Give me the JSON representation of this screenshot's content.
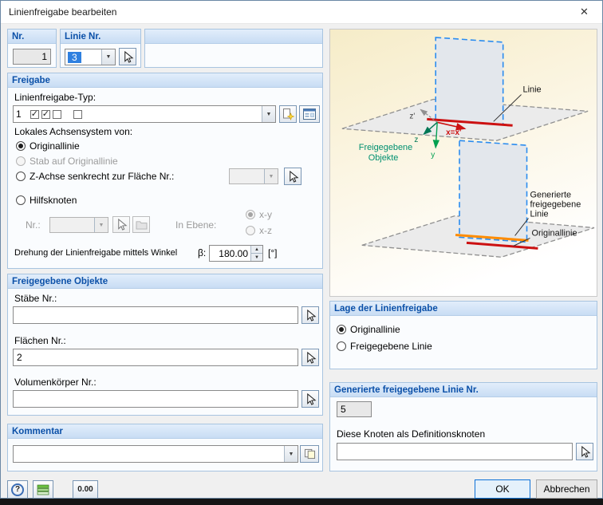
{
  "window": {
    "title": "Linienfreigabe bearbeiten",
    "close_icon": "✕"
  },
  "header_groups": {
    "nr": {
      "title": "Nr.",
      "value": "1"
    },
    "linie": {
      "title": "Linie Nr.",
      "value": "3"
    }
  },
  "freigabe": {
    "title": "Freigabe",
    "typ_label": "Linienfreigabe-Typ:",
    "typ_value": "1",
    "achsen_label": "Lokales Achsensystem von:",
    "radio_originallinie": "Originallinie",
    "radio_stab": "Stab auf Originallinie",
    "radio_zachse": "Z-Achse senkrecht zur Fläche Nr.:",
    "radio_hilfsknoten": "Hilfsknoten",
    "nr_label": "Nr.:",
    "in_ebene_label": "In Ebene:",
    "radio_xy": "x-y",
    "radio_xz": "x-z",
    "drehung_label": "Drehung der Linienfreigabe mittels Winkel",
    "beta_label": "β:",
    "beta_value": "180.00",
    "unit_label": "[°]"
  },
  "objekte": {
    "title": "Freigegebene Objekte",
    "staebe_label": "Stäbe Nr.:",
    "staebe_value": "",
    "flaechen_label": "Flächen Nr.:",
    "flaechen_value": "2",
    "volumen_label": "Volumenkörper Nr.:",
    "volumen_value": ""
  },
  "kommentar": {
    "title": "Kommentar",
    "value": ""
  },
  "diagram": {
    "label_linie": "Linie",
    "label_freigegebene": "Freigegebene",
    "label_objekte": "Objekte",
    "label_generierte_1": "Generierte",
    "label_generierte_2": "freigegebene",
    "label_generierte_3": "Linie",
    "label_originallinie": "Originallinie",
    "axis_z_strich": "z'",
    "axis_x": "x=x'",
    "axis_z": "z",
    "axis_y": "y"
  },
  "lage": {
    "title": "Lage der Linienfreigabe",
    "radio_originallinie": "Originallinie",
    "radio_freigegebene": "Freigegebene Linie"
  },
  "generierte": {
    "title": "Generierte freigegebene Linie Nr.",
    "value": "5",
    "knoten_label": "Diese Knoten als Definitionsknoten",
    "knoten_value": ""
  },
  "footer": {
    "help_label": "?",
    "decimals_label": "0.00",
    "ok_label": "OK",
    "cancel_label": "Abbrechen"
  },
  "colors": {
    "group_header_text": "#0b50a8",
    "accent_red": "#cc1111",
    "accent_orange": "#ff8c00",
    "accent_blue_dash": "#2a8cf0",
    "accent_teal": "#009070"
  }
}
